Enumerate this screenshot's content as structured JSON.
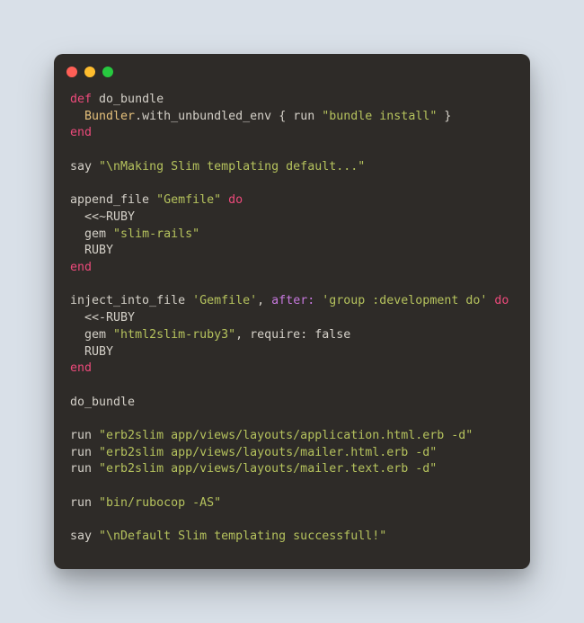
{
  "code": {
    "l1_def": "def",
    "l1_name": " do_bundle",
    "l2_indent": "  ",
    "l2_const": "Bundler",
    "l2_dot": ".",
    "l2_method": "with_unbundled_env",
    "l2_brace_open": " { ",
    "l2_run": "run ",
    "l2_str": "\"bundle install\"",
    "l2_brace_close": " }",
    "l3_end": "end",
    "l5_say": "say ",
    "l5_str": "\"\\nMaking Slim templating default...\"",
    "l7_fn": "append_file ",
    "l7_str": "\"Gemfile\"",
    "l7_sp": " ",
    "l7_do": "do",
    "l8": "  <<~RUBY",
    "l9_pre": "  gem ",
    "l9_str": "\"slim-rails\"",
    "l10": "  RUBY",
    "l11_end": "end",
    "l13_fn": "inject_into_file ",
    "l13_str1": "'Gemfile'",
    "l13_comma": ", ",
    "l13_sym": "after:",
    "l13_sp": " ",
    "l13_str2": "'group :development do'",
    "l13_sp2": " ",
    "l13_do": "do",
    "l14": "  <<-RUBY",
    "l15_pre": "  gem ",
    "l15_str": "\"html2slim-ruby3\"",
    "l15_mid": ", require: ",
    "l15_bool": "false",
    "l16": "  RUBY",
    "l17_end": "end",
    "l19": "do_bundle",
    "l21_run": "run ",
    "l21_str": "\"erb2slim app/views/layouts/application.html.erb -d\"",
    "l22_run": "run ",
    "l22_str": "\"erb2slim app/views/layouts/mailer.html.erb -d\"",
    "l23_run": "run ",
    "l23_str": "\"erb2slim app/views/layouts/mailer.text.erb -d\"",
    "l25_run": "run ",
    "l25_str": "\"bin/rubocop -AS\"",
    "l27_say": "say ",
    "l27_str": "\"\\nDefault Slim templating successfull!\""
  }
}
